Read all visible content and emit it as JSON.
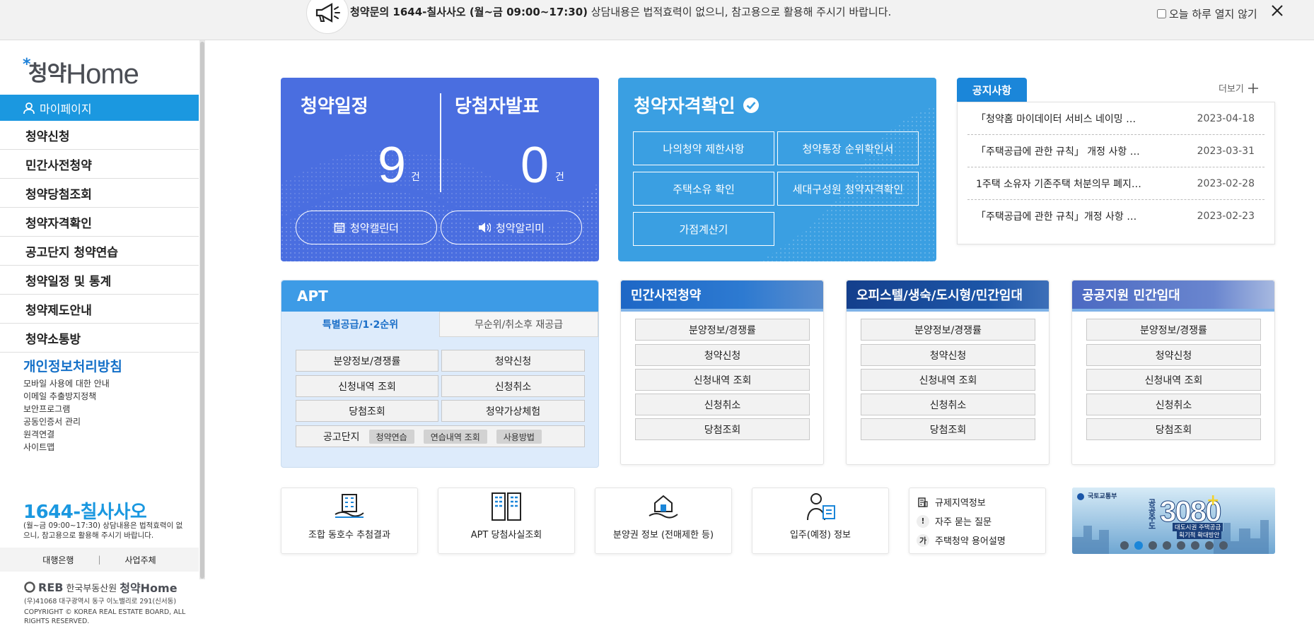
{
  "top_notice": {
    "text_strong": "청약문의 1644-칠사사오 (월~금 09:00~17:30)",
    "text_rest": " 상담내용은 법적효력이 없으니, 참고용으로 활용해 주시기 바랍니다.",
    "dismiss_label": "오늘 하루 열지 않기",
    "megaphone_icon": "megaphone-icon",
    "close_icon": "close-icon"
  },
  "sidebar": {
    "logo_ko": "청약",
    "logo_en": "Home",
    "logo_star": "*",
    "mypage": "마이페이지",
    "items": [
      "청약신청",
      "민간사전청약",
      "청약당첨조회",
      "청약자격확인",
      "공고단지 청약연습",
      "청약일정 및 통계",
      "청약제도안내",
      "청약소통방"
    ],
    "privacy_title": "개인정보처리방침",
    "links": [
      "모바일 사용에 대한 안내",
      "이메일 추출방지정책",
      "보안프로그램",
      "공동인증서 관리",
      "원격연결",
      "사이트맵"
    ],
    "phone": "1644-칠사사오",
    "phone_desc": "(월~금 09:00~17:30) 상담내용은 법적효력이 없으니, 참고용으로 활용해 주시기 바랍니다.",
    "bank": "대행은행",
    "separator": "|",
    "business": "사업주체",
    "footer_logo": "REB",
    "footer_org": "한국부동산원",
    "footer_brand": "청약Home",
    "footer_addr": "(우)41068 대구광역시 동구 이노밸리로 291(신서동)",
    "footer_copy": "COPYRIGHT © KOREA REAL ESTATE BOARD, ALL RIGHTS RESERVED."
  },
  "schedule_card": {
    "schedule_title": "청약일정",
    "schedule_count": "9",
    "announce_title": "당첨자발표",
    "announce_count": "0",
    "unit": "건",
    "calendar_btn": "청약캘린더",
    "alarm_btn": "청약알리미"
  },
  "qualify_card": {
    "title": "청약자격확인",
    "buttons": [
      "나의청약 제한사항",
      "청약통장 순위확인서",
      "주택소유 확인",
      "세대구성원 청약자격확인",
      "가점계산기"
    ]
  },
  "notices": {
    "tab": "공지사항",
    "more": "더보기",
    "rows": [
      {
        "title": "「청약홈 마이데이터 서비스 네이밍 …",
        "date": "2023-04-18"
      },
      {
        "title": "「주택공급에 관한 규칙」 개정 사항 …",
        "date": "2023-03-31"
      },
      {
        "title": "1주택 소유자 기존주택 처분의무 폐지…",
        "date": "2023-02-28"
      },
      {
        "title": "「주택공급에 관한 규칙」개정 사항 …",
        "date": "2023-02-23"
      }
    ]
  },
  "apt": {
    "title": "APT",
    "tab_on": "특별공급/1·2순위",
    "tab_off": "무순위/취소후 재공급",
    "buttons": [
      "분양정보/경쟁률",
      "청약신청",
      "신청내역 조회",
      "신청취소",
      "당첨조회",
      "청약가상체험"
    ],
    "bottom_label": "공고단지",
    "chips": [
      "청약연습",
      "연습내역 조회",
      "사용방법"
    ]
  },
  "categories": [
    {
      "title": "민간사전청약",
      "buttons": [
        "분양정보/경쟁률",
        "청약신청",
        "신청내역 조회",
        "신청취소",
        "당첨조회"
      ]
    },
    {
      "title": "오피스텔/생숙/도시형/민간임대",
      "buttons": [
        "분양정보/경쟁률",
        "청약신청",
        "신청내역 조회",
        "신청취소",
        "당첨조회"
      ]
    },
    {
      "title": "공공지원 민간임대",
      "buttons": [
        "분양정보/경쟁률",
        "청약신청",
        "신청내역 조회",
        "신청취소",
        "당첨조회"
      ]
    }
  ],
  "shortcuts": [
    "조합 동호수 추첨결과",
    "APT 당첨사실조회",
    "분양권 정보 (전매제한 등)",
    "입주(예정) 정보"
  ],
  "quick": [
    {
      "icon": "building-doc-icon",
      "label": "규제지역정보"
    },
    {
      "icon": "exclamation-icon",
      "label": "자주 묻는 질문"
    },
    {
      "icon": "ga-icon",
      "label": "주택청약 용어설명"
    }
  ],
  "banner": {
    "ministry": "국토교통부",
    "vertical": "공공\n주도",
    "big": "3080",
    "plus": "+",
    "caption1": "대도시권 주택공급",
    "caption2": "획기적 확대방안",
    "slides": 8,
    "active": 1
  },
  "colors": {
    "primary": "#1b98e0",
    "card_blue": "#4a6ee0",
    "card_sky": "#3a9fe2"
  }
}
